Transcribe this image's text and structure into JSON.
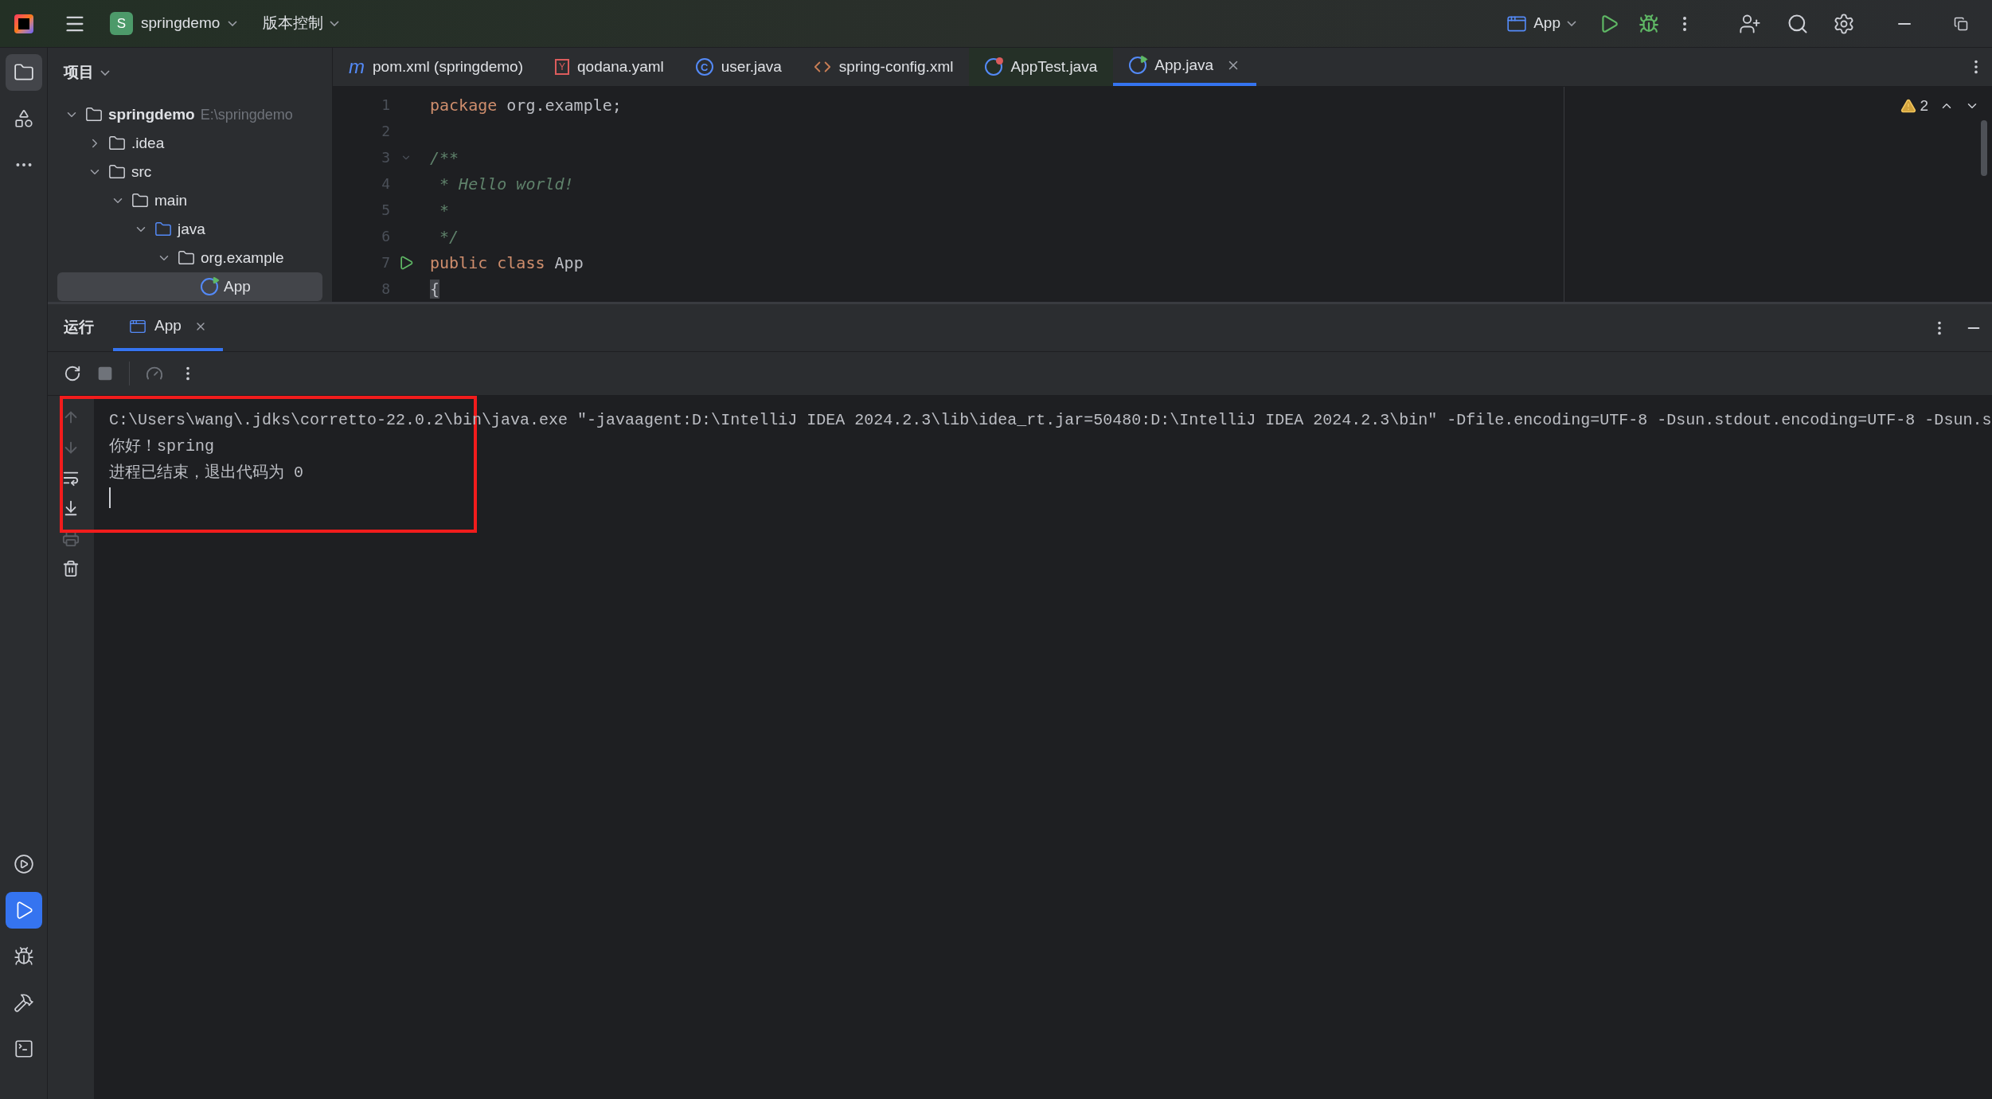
{
  "title_bar": {
    "project": {
      "badge": "S",
      "name": "springdemo"
    },
    "vcs": "版本控制",
    "run_config": "App"
  },
  "left_strip": {
    "top": [
      {
        "kind": "folder",
        "selected": true
      },
      {
        "kind": "structure",
        "selected": false
      },
      {
        "kind": "more",
        "selected": false
      }
    ],
    "bottom": [
      {
        "kind": "services",
        "selected": false
      },
      {
        "kind": "run",
        "selected": true
      },
      {
        "kind": "debug",
        "selected": false
      },
      {
        "kind": "build",
        "selected": false
      },
      {
        "kind": "terminal",
        "selected": false
      }
    ]
  },
  "project_panel": {
    "title": "项目",
    "tree": [
      {
        "label": "springdemo",
        "hint": "E:\\springdemo",
        "kind": "module",
        "expanded": true,
        "selected": false,
        "children": [
          {
            "label": ".idea",
            "kind": "folder",
            "expanded": false,
            "selected": false
          },
          {
            "label": "src",
            "kind": "folder",
            "expanded": true,
            "selected": false,
            "children": [
              {
                "label": "main",
                "kind": "folder",
                "expanded": true,
                "selected": false,
                "children": [
                  {
                    "label": "java",
                    "kind": "source",
                    "expanded": true,
                    "selected": false,
                    "children": [
                      {
                        "label": "org.example",
                        "kind": "package",
                        "expanded": true,
                        "selected": false,
                        "children": [
                          {
                            "label": "App",
                            "kind": "class",
                            "selected": true
                          }
                        ]
                      }
                    ]
                  }
                ]
              }
            ]
          }
        ]
      }
    ]
  },
  "editor": {
    "tabs": [
      {
        "label": "pom.xml (springdemo)",
        "kind": "maven",
        "badge": "m",
        "selected": false
      },
      {
        "label": "qodana.yaml",
        "kind": "yaml",
        "badge": "Y",
        "selected": false
      },
      {
        "label": "user.java",
        "kind": "class",
        "badge": "C",
        "selected": false
      },
      {
        "label": "spring-config.xml",
        "kind": "xml",
        "selected": false
      },
      {
        "label": "AppTest.java",
        "kind": "test",
        "selected": false
      },
      {
        "label": "App.java",
        "kind": "app",
        "selected": true
      }
    ],
    "warnings": "2",
    "lines": [
      {
        "number": "1",
        "tokens": [
          {
            "text": "package ",
            "kind": "keyword"
          },
          {
            "text": "org.example;",
            "kind": "plain"
          }
        ]
      },
      {
        "number": "2"
      },
      {
        "number": "3",
        "fold": true,
        "tokens": [
          {
            "text": "/**",
            "kind": "doc"
          }
        ]
      },
      {
        "number": "4",
        "tokens": [
          {
            "text": " * Hello world!",
            "kind": "doc"
          }
        ]
      },
      {
        "number": "5",
        "tokens": [
          {
            "text": " *",
            "kind": "doc"
          }
        ]
      },
      {
        "number": "6",
        "tokens": [
          {
            "text": " */",
            "kind": "doc"
          }
        ]
      },
      {
        "number": "7",
        "run": true,
        "tokens": [
          {
            "text": "public class ",
            "kind": "keyword"
          },
          {
            "text": "App",
            "kind": "plain"
          }
        ]
      },
      {
        "number": "8",
        "tokens": [
          {
            "text": "{",
            "kind": "brace"
          }
        ]
      }
    ]
  },
  "run_panel": {
    "title": "运行",
    "tabs": [
      {
        "label": "App",
        "selected": true
      }
    ],
    "console": [
      "C:\\Users\\wang\\.jdks\\corretto-22.0.2\\bin\\java.exe \"-javaagent:D:\\IntelliJ IDEA 2024.2.3\\lib\\idea_rt.jar=50480:D:\\IntelliJ IDEA 2024.2.3\\bin\" -Dfile.encoding=UTF-8 -Dsun.stdout.encoding=UTF-8 -Dsun.s",
      "你好！spring",
      "进程已结束，退出代码为 0"
    ]
  }
}
